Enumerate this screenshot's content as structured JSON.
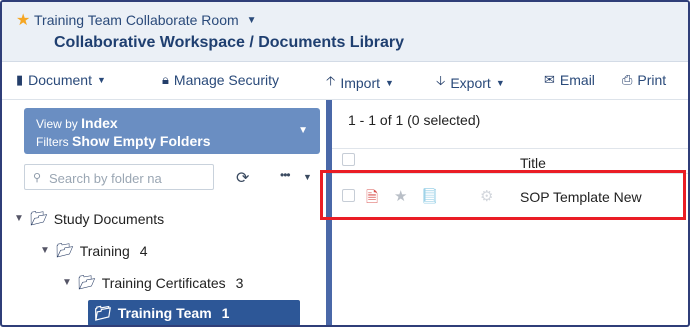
{
  "header": {
    "room_name": "Training Team Collaborate Room",
    "breadcrumb": "Collaborative Workspace / Documents Library"
  },
  "toolbar": {
    "document_label": "Document",
    "manage_security_label": "Manage Security",
    "import_label": "Import",
    "export_label": "Export",
    "email_label": "Email",
    "print_label": "Print"
  },
  "sidebar": {
    "view_by_prefix": "View by",
    "view_by_value": "Index",
    "filters_prefix": "Filters",
    "filters_value": "Show Empty Folders",
    "search_placeholder": "Search by folder na",
    "tree": [
      {
        "label": "Study Documents",
        "count": ""
      },
      {
        "label": "Training",
        "count": "4"
      },
      {
        "label": "Training Certificates",
        "count": "3"
      },
      {
        "label": "Training Team",
        "count": "1"
      }
    ]
  },
  "main": {
    "count_text": "1 - 1 of 1 (0 selected)",
    "columns": {
      "title": "Title"
    },
    "rows": [
      {
        "title": "SOP Template New"
      }
    ]
  },
  "colors": {
    "accent": "#2d5797",
    "highlight": "#ea1d25",
    "star": "#f5a623",
    "pdf": "#d9534f"
  }
}
